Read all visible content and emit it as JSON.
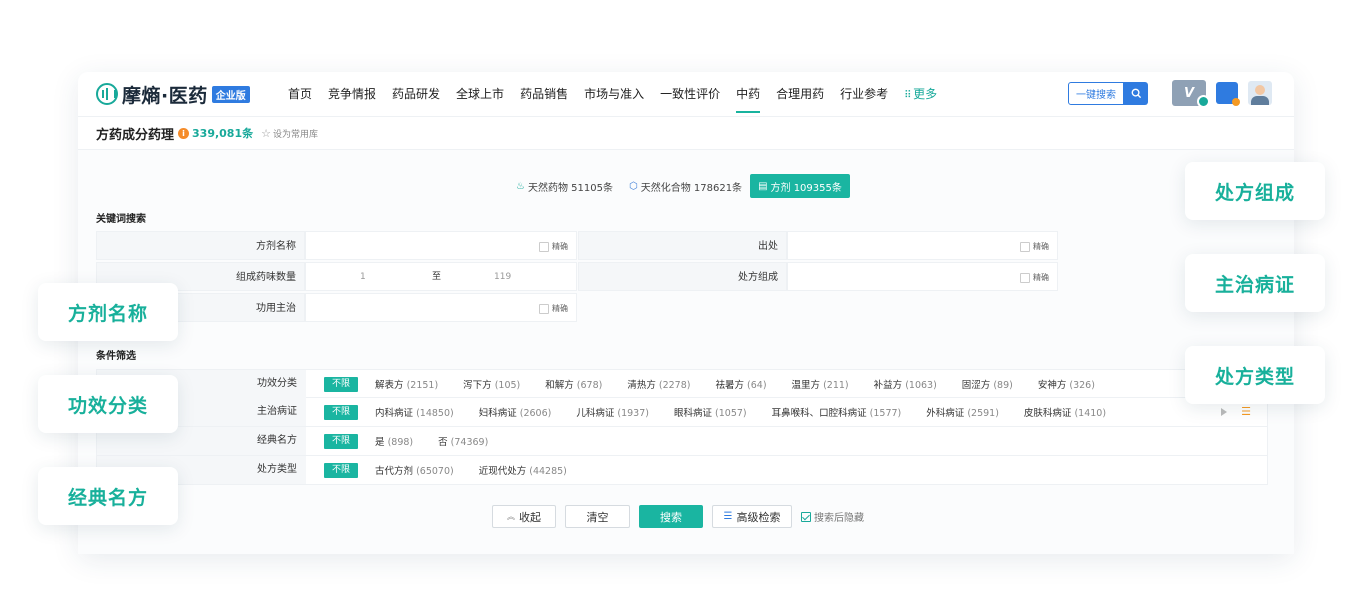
{
  "app": {
    "logo_text": "摩熵·医药",
    "logo_badge": "企业版"
  },
  "nav": {
    "items": [
      "首页",
      "竞争情报",
      "药品研发",
      "全球上市",
      "药品销售",
      "市场与准入",
      "一致性评价",
      "中药",
      "合理用药",
      "行业参考"
    ],
    "active": "中药",
    "more_label": "更多",
    "search_label": "一键搜索"
  },
  "subheader": {
    "title": "方药成分药理",
    "count": "339,081条",
    "fav_label": "设为常用库"
  },
  "tabs": [
    {
      "label": "天然药物 51105条",
      "icon": "leaf-icon",
      "active": false
    },
    {
      "label": "天然化合物 178621条",
      "icon": "hexagon-icon",
      "active": false
    },
    {
      "label": "方剂 109355条",
      "icon": "document-icon",
      "active": true
    }
  ],
  "keyword": {
    "section_label": "关键词搜索",
    "exact_label": "精确",
    "fields": {
      "name": "方剂名称",
      "source": "出处",
      "herb_count": "组成药味数量",
      "composition": "处方组成",
      "indication": "功用主治"
    },
    "range_min": "1",
    "range_to": "至",
    "range_max": "119"
  },
  "filters": {
    "section_label": "条件筛选",
    "all_label": "不限",
    "rows": [
      {
        "label": "功效分类",
        "options": [
          {
            "name": "解表方",
            "count": "(2151)"
          },
          {
            "name": "泻下方",
            "count": "(105)"
          },
          {
            "name": "和解方",
            "count": "(678)"
          },
          {
            "name": "清热方",
            "count": "(2278)"
          },
          {
            "name": "祛暑方",
            "count": "(64)"
          },
          {
            "name": "温里方",
            "count": "(211)"
          },
          {
            "name": "补益方",
            "count": "(1063)"
          },
          {
            "name": "固涩方",
            "count": "(89)"
          },
          {
            "name": "安神方",
            "count": "(326)"
          }
        ]
      },
      {
        "label": "主治病证",
        "options": [
          {
            "name": "内科病证",
            "count": "(14850)"
          },
          {
            "name": "妇科病证",
            "count": "(2606)"
          },
          {
            "name": "儿科病证",
            "count": "(1937)"
          },
          {
            "name": "眼科病证",
            "count": "(1057)"
          },
          {
            "name": "耳鼻喉科、口腔科病证",
            "count": "(1577)"
          },
          {
            "name": "外科病证",
            "count": "(2591)"
          },
          {
            "name": "皮肤科病证",
            "count": "(1410)"
          }
        ]
      },
      {
        "label": "经典名方",
        "options": [
          {
            "name": "是",
            "count": "(898)"
          },
          {
            "name": "否",
            "count": "(74369)"
          }
        ]
      },
      {
        "label": "处方类型",
        "options": [
          {
            "name": "古代方剂",
            "count": "(65070)"
          },
          {
            "name": "近现代处方",
            "count": "(44285)"
          }
        ]
      }
    ]
  },
  "actions": {
    "collapse": "收起",
    "clear": "清空",
    "search": "搜索",
    "advanced": "高级检索",
    "hide_after": "搜索后隐藏"
  },
  "callouts": {
    "left": [
      "方剂名称",
      "功效分类",
      "经典名方"
    ],
    "right": [
      "处方组成",
      "主治病证",
      "处方类型"
    ]
  },
  "colors": {
    "accent": "#1ab5a1",
    "brand_blue": "#2f7be0",
    "warning": "#f58c2a"
  }
}
